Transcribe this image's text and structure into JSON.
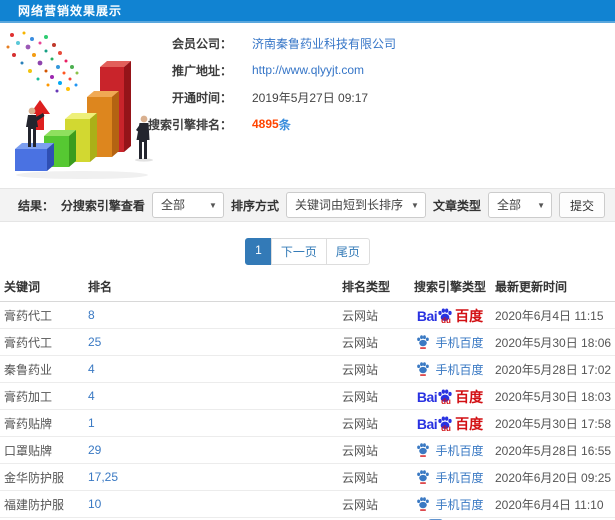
{
  "header": {
    "title": "网络营销效果展示"
  },
  "profile": {
    "member_company": {
      "label": "会员公司：",
      "value": "济南秦鲁药业科技有限公司"
    },
    "promo_url": {
      "label": "推广地址：",
      "value": "http://www.qlyyjt.com"
    },
    "open_time": {
      "label": "开通时间：",
      "value": "2019年5月27日 09:17"
    },
    "engine_rank": {
      "label": "搜索引擎排名：",
      "value": "4895",
      "unit": "条"
    }
  },
  "filter": {
    "section_label": "结果：",
    "engine_view_label": "分搜索引擎查看",
    "engine_view_value": "全部",
    "sort_label": "排序方式",
    "sort_value": "关键词由短到长排序",
    "article_label": "文章类型",
    "article_value": "全部",
    "submit": "提交"
  },
  "pagination": {
    "current": "1",
    "next": "下一页",
    "last": "尾页"
  },
  "engines": {
    "baidu_pc": {
      "text_bai": "Bai",
      "text_du": "du",
      "text_cn": "百度"
    },
    "baidu_mobile": {
      "label": "手机百度"
    }
  },
  "table": {
    "columns": [
      "关键词",
      "排名",
      "排名类型",
      "搜索引擎类型",
      "最新更新时间"
    ],
    "rows": [
      {
        "keyword": "膏药代工",
        "rank": "8",
        "rank_type": "云网站",
        "engine": "baidu_pc",
        "updated": "2020年6月4日 11:15"
      },
      {
        "keyword": "膏药代工",
        "rank": "25",
        "rank_type": "云网站",
        "engine": "baidu_mobile",
        "updated": "2020年5月30日 18:06"
      },
      {
        "keyword": "秦鲁药业",
        "rank": "4",
        "rank_type": "云网站",
        "engine": "baidu_mobile",
        "updated": "2020年5月28日 17:02"
      },
      {
        "keyword": "膏药加工",
        "rank": "4",
        "rank_type": "云网站",
        "engine": "baidu_pc",
        "updated": "2020年5月30日 18:03"
      },
      {
        "keyword": "膏药贴牌",
        "rank": "1",
        "rank_type": "云网站",
        "engine": "baidu_pc",
        "updated": "2020年5月30日 17:58"
      },
      {
        "keyword": "口罩贴牌",
        "rank": "29",
        "rank_type": "云网站",
        "engine": "baidu_mobile",
        "updated": "2020年5月28日 16:55"
      },
      {
        "keyword": "金华防护服",
        "rank": "17,25",
        "rank_type": "云网站",
        "engine": "baidu_mobile",
        "updated": "2020年6月20日 09:25"
      },
      {
        "keyword": "福建防护服",
        "rank": "10",
        "rank_type": "云网站",
        "engine": "baidu_mobile",
        "updated": "2020年6月4日 11:10"
      }
    ]
  },
  "colors": {
    "topbar_blue": "#1183d2",
    "link_blue": "#3575c7",
    "count_red": "#ff4400",
    "pagination_blue": "#337ab7",
    "rank_blue": "#3a79c3",
    "baidu_blue": "#2932e1",
    "baidu_red": "#d20f13"
  }
}
